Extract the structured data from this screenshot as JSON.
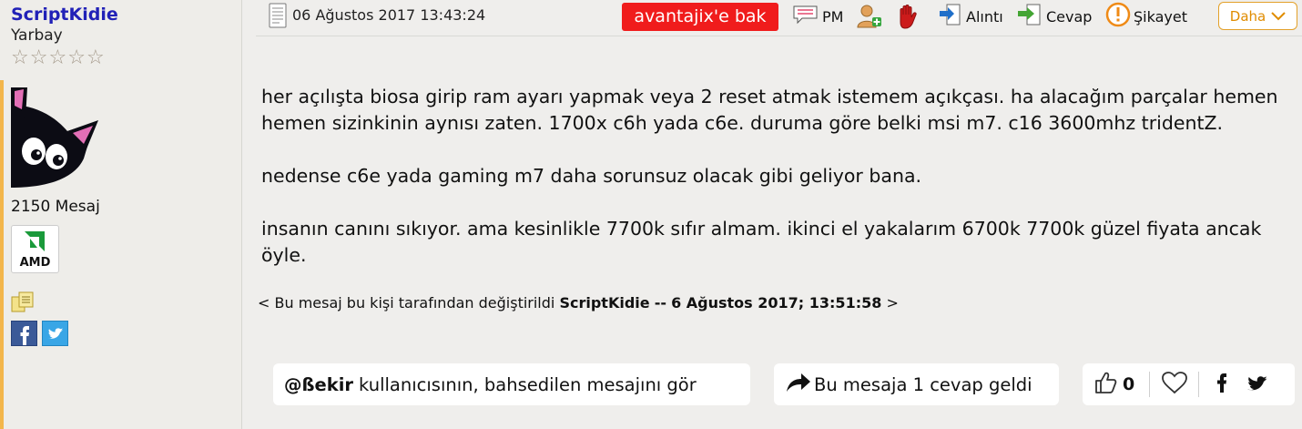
{
  "user": {
    "name": "ScriptKidie",
    "rank": "Yarbay",
    "stars": [
      "☆",
      "☆",
      "☆",
      "☆",
      "☆"
    ],
    "message_count": "2150 Mesaj",
    "badge_text": "AMD",
    "colors": {
      "name": "#2121b7",
      "accent": "#f3b64b"
    }
  },
  "header": {
    "date": "06 Ağustos 2017 13:43:24",
    "ad_label": "avantajix'e bak",
    "pm_label": "PM",
    "quote_label": "Alıntı",
    "reply_label": "Cevap",
    "report_label": "Şikayet",
    "more_label": "Daha",
    "colors": {
      "ad": "#f01c1c",
      "more_border": "#e3a12a"
    }
  },
  "post": {
    "paragraphs": [
      "her açılışta biosa girip ram ayarı yapmak veya 2 reset atmak istemem açıkçası. ha alacağım parçalar hemen hemen sizinkinin aynısı zaten. 1700x c6h yada c6e. duruma göre belki msi m7. c16 3600mhz tridentZ.",
      "nedense c6e yada gaming m7 daha sorunsuz olacak gibi geliyor bana.",
      "insanın canını sıkıyor. ama kesinlikle 7700k sıfır almam. ikinci el yakalarım 6700k 7700k güzel fiyata ancak öyle."
    ],
    "edit_note": {
      "prefix": "< Bu mesaj bu kişi tarafından değiştirildi",
      "editor": "ScriptKidie",
      "separator": "--",
      "timestamp": "6 Ağustos 2017; 13:51:58",
      "suffix": ">"
    }
  },
  "footer": {
    "quoted_user": "@ßekir",
    "quoted_text": "kullanıcısının, bahsedilen mesajını gör",
    "reply_text": "Bu mesaja 1 cevap geldi",
    "like_count": "0"
  }
}
